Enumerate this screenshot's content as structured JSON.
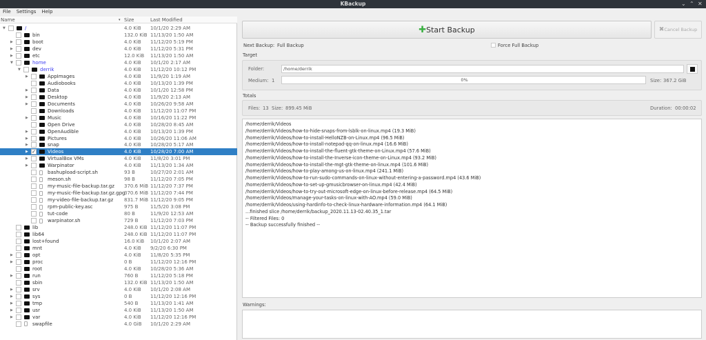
{
  "window": {
    "title": "KBackup",
    "controls": [
      "⌄",
      "⌃",
      "✕"
    ]
  },
  "menu": [
    "File",
    "Settings",
    "Help"
  ],
  "tree": {
    "headers": {
      "name": "Name",
      "size": "Size",
      "modified": "Last Modified",
      "sort_icon": "▾"
    },
    "rows": [
      {
        "name": "/",
        "size": "4.0 KiB",
        "date": "10/1/20 2:29 AM",
        "d": 0,
        "e": "open",
        "t": "dir",
        "blue": true
      },
      {
        "name": "bin",
        "size": "132.0 KiB",
        "date": "11/13/20 1:50 AM",
        "d": 1,
        "e": "",
        "t": "link"
      },
      {
        "name": "boot",
        "size": "4.0 KiB",
        "date": "11/12/20 5:19 PM",
        "d": 1,
        "e": "closed",
        "t": "dir"
      },
      {
        "name": "dev",
        "size": "4.0 KiB",
        "date": "11/12/20 5:31 PM",
        "d": 1,
        "e": "closed",
        "t": "dir"
      },
      {
        "name": "etc",
        "size": "12.0 KiB",
        "date": "11/13/20 1:50 AM",
        "d": 1,
        "e": "closed",
        "t": "dir"
      },
      {
        "name": "home",
        "size": "4.0 KiB",
        "date": "10/1/20 2:17 AM",
        "d": 1,
        "e": "open",
        "t": "dir",
        "blue": true
      },
      {
        "name": "derrik",
        "size": "4.0 KiB",
        "date": "11/12/20 10:12 PM",
        "d": 2,
        "e": "open",
        "t": "dir",
        "blue": true
      },
      {
        "name": "AppImages",
        "size": "4.0 KiB",
        "date": "11/9/20 1:19 AM",
        "d": 3,
        "e": "closed",
        "t": "dir"
      },
      {
        "name": "Audiobooks",
        "size": "4.0 KiB",
        "date": "10/13/20 1:39 PM",
        "d": 3,
        "e": "",
        "t": "dir"
      },
      {
        "name": "Data",
        "size": "4.0 KiB",
        "date": "10/1/20 12:58 PM",
        "d": 3,
        "e": "closed",
        "t": "dir"
      },
      {
        "name": "Desktop",
        "size": "4.0 KiB",
        "date": "11/9/20 2:13 AM",
        "d": 3,
        "e": "closed",
        "t": "dir"
      },
      {
        "name": "Documents",
        "size": "4.0 KiB",
        "date": "10/26/20 9:58 AM",
        "d": 3,
        "e": "closed",
        "t": "dir"
      },
      {
        "name": "Downloads",
        "size": "4.0 KiB",
        "date": "11/12/20 11:07 PM",
        "d": 3,
        "e": "",
        "t": "dir"
      },
      {
        "name": "Music",
        "size": "4.0 KiB",
        "date": "10/16/20 11:22 PM",
        "d": 3,
        "e": "closed",
        "t": "dir"
      },
      {
        "name": "Open Drive",
        "size": "4.0 KiB",
        "date": "10/28/20 8:45 AM",
        "d": 3,
        "e": "",
        "t": "dir"
      },
      {
        "name": "OpenAudible",
        "size": "4.0 KiB",
        "date": "10/13/20 1:39 PM",
        "d": 3,
        "e": "closed",
        "t": "dir"
      },
      {
        "name": "Pictures",
        "size": "4.0 KiB",
        "date": "10/26/20 11:06 AM",
        "d": 3,
        "e": "closed",
        "t": "dir"
      },
      {
        "name": "snap",
        "size": "4.0 KiB",
        "date": "10/28/20 5:17 AM",
        "d": 3,
        "e": "closed",
        "t": "dir"
      },
      {
        "name": "Videos",
        "size": "4.0 KiB",
        "date": "10/28/20 7:00 AM",
        "d": 3,
        "e": "closed",
        "t": "dir",
        "checked": true,
        "selected": true
      },
      {
        "name": "VirtualBox VMs",
        "size": "4.0 KiB",
        "date": "11/8/20 3:01 PM",
        "d": 3,
        "e": "closed",
        "t": "dir"
      },
      {
        "name": "Warpinator",
        "size": "4.0 KiB",
        "date": "11/13/20 1:34 AM",
        "d": 3,
        "e": "closed",
        "t": "dir"
      },
      {
        "name": "bashupload-script.sh",
        "size": "93 B",
        "date": "10/27/20 2:01 AM",
        "d": 3,
        "e": "",
        "t": "file"
      },
      {
        "name": "meson.sh",
        "size": "98 B",
        "date": "11/12/20 7:05 PM",
        "d": 3,
        "e": "",
        "t": "file"
      },
      {
        "name": "my-music-file-backup.tar.gz",
        "size": "370.6 MiB",
        "date": "11/12/20 7:37 PM",
        "d": 3,
        "e": "",
        "t": "file"
      },
      {
        "name": "my-music-file-backup.tar.gz.gpg",
        "size": "370.6 MiB",
        "date": "11/12/20 7:44 PM",
        "d": 3,
        "e": "",
        "t": "file"
      },
      {
        "name": "my-video-file-backup.tar.gz",
        "size": "831.7 MiB",
        "date": "11/12/20 9:05 PM",
        "d": 3,
        "e": "",
        "t": "file"
      },
      {
        "name": "rpm-public-key.asc",
        "size": "975 B",
        "date": "11/5/20 3:08 PM",
        "d": 3,
        "e": "",
        "t": "file"
      },
      {
        "name": "tut-code",
        "size": "80 B",
        "date": "11/9/20 12:53 AM",
        "d": 3,
        "e": "",
        "t": "file"
      },
      {
        "name": "warpinator.sh",
        "size": "729 B",
        "date": "11/12/20 7:03 PM",
        "d": 3,
        "e": "",
        "t": "file"
      },
      {
        "name": "lib",
        "size": "248.0 KiB",
        "date": "11/12/20 11:07 PM",
        "d": 1,
        "e": "",
        "t": "link"
      },
      {
        "name": "lib64",
        "size": "248.0 KiB",
        "date": "11/12/20 11:07 PM",
        "d": 1,
        "e": "",
        "t": "link"
      },
      {
        "name": "lost+found",
        "size": "16.0 KiB",
        "date": "10/1/20 2:07 AM",
        "d": 1,
        "e": "",
        "t": "dir"
      },
      {
        "name": "mnt",
        "size": "4.0 KiB",
        "date": "9/2/20 6:30 PM",
        "d": 1,
        "e": "",
        "t": "dir"
      },
      {
        "name": "opt",
        "size": "4.0 KiB",
        "date": "11/8/20 5:35 PM",
        "d": 1,
        "e": "closed",
        "t": "dir"
      },
      {
        "name": "proc",
        "size": "0 B",
        "date": "11/12/20 12:16 PM",
        "d": 1,
        "e": "closed",
        "t": "dir"
      },
      {
        "name": "root",
        "size": "4.0 KiB",
        "date": "10/28/20 5:36 AM",
        "d": 1,
        "e": "",
        "t": "dir"
      },
      {
        "name": "run",
        "size": "760 B",
        "date": "11/12/20 5:18 PM",
        "d": 1,
        "e": "closed",
        "t": "dir"
      },
      {
        "name": "sbin",
        "size": "132.0 KiB",
        "date": "11/13/20 1:50 AM",
        "d": 1,
        "e": "",
        "t": "link"
      },
      {
        "name": "srv",
        "size": "4.0 KiB",
        "date": "10/1/20 2:08 AM",
        "d": 1,
        "e": "closed",
        "t": "dir"
      },
      {
        "name": "sys",
        "size": "0 B",
        "date": "11/12/20 12:16 PM",
        "d": 1,
        "e": "closed",
        "t": "dir"
      },
      {
        "name": "tmp",
        "size": "540 B",
        "date": "11/13/20 1:41 AM",
        "d": 1,
        "e": "closed",
        "t": "dir"
      },
      {
        "name": "usr",
        "size": "4.0 KiB",
        "date": "11/13/20 1:50 AM",
        "d": 1,
        "e": "closed",
        "t": "dir"
      },
      {
        "name": "var",
        "size": "4.0 KiB",
        "date": "11/12/20 12:16 PM",
        "d": 1,
        "e": "closed",
        "t": "dir"
      },
      {
        "name": "swapfile",
        "size": "4.0 GiB",
        "date": "10/1/20 2:29 AM",
        "d": 1,
        "e": "",
        "t": "file"
      }
    ]
  },
  "actions": {
    "start": "Start Backup",
    "cancel": "Cancel Backup"
  },
  "next_backup": {
    "label": "Next Backup:",
    "value": "Full Backup"
  },
  "force_full": {
    "label": "Force Full Backup",
    "checked": false
  },
  "target": {
    "title": "Target",
    "folder_label": "Folder:",
    "folder_value": "/home/derrik",
    "medium_label": "Medium:",
    "medium_value": "1",
    "progress": 0,
    "progress_text": "0%",
    "size_label": "Size:",
    "size_value": "367.2 GiB"
  },
  "totals": {
    "title": "Totals",
    "files_label": "Files:",
    "files": "13",
    "size_label": "Size:",
    "size": "899.45 MiB",
    "duration_label": "Duration:",
    "duration": "00:00:02"
  },
  "log": [
    "/home/derrik/Videos",
    "/home/derrik/Videos/how-to-hide-snaps-from-lsblk-on-linux.mp4 (19.3 MiB)",
    "/home/derrik/Videos/how-to-install-HelloNZB-on-Linux.mp4 (96.5 MiB)",
    "/home/derrik/Videos/how-to-install-notepad-qq-on-linux.mp4 (16.6 MiB)",
    "/home/derrik/Videos/how-to-install-the-fluent-gtk-theme-on-Linux.mp4 (57.6 MiB)",
    "/home/derrik/Videos/how-to-install-the-Inverse-icon-theme-on-Linux.mp4 (93.2 MiB)",
    "/home/derrik/Videos/how-to-install-the-mgt-gtk-theme-on-linux.mp4 (101.6 MiB)",
    "/home/derrik/Videos/how-to-play-among-us-on-linux.mp4 (241.1 MiB)",
    "/home/derrik/Videos/how-to-run-sudo-commands-on-linux-without-entering-a-password.mp4 (43.6 MiB)",
    "/home/derrik/Videos/how-to-set-up-gmusicbrowser-on-linux.mp4 (42.4 MiB)",
    "/home/derrik/Videos/how-to-try-out-microsoft-edge-on-linux-before-release.mp4 (64.5 MiB)",
    "/home/derrik/Videos/manage-your-tasks-on-linux-with-AO.mp4 (59.0 MiB)",
    "/home/derrik/Videos/using-hardinfo-to-check-linux-hardware-information.mp4 (64.1 MiB)",
    "...finished slice /home/derrik/backup_2020.11.13-02.40.35_1.tar",
    "-- Filtered Files: 0",
    "-- Backup successfully finished --"
  ],
  "warnings": {
    "title": "Warnings:"
  }
}
